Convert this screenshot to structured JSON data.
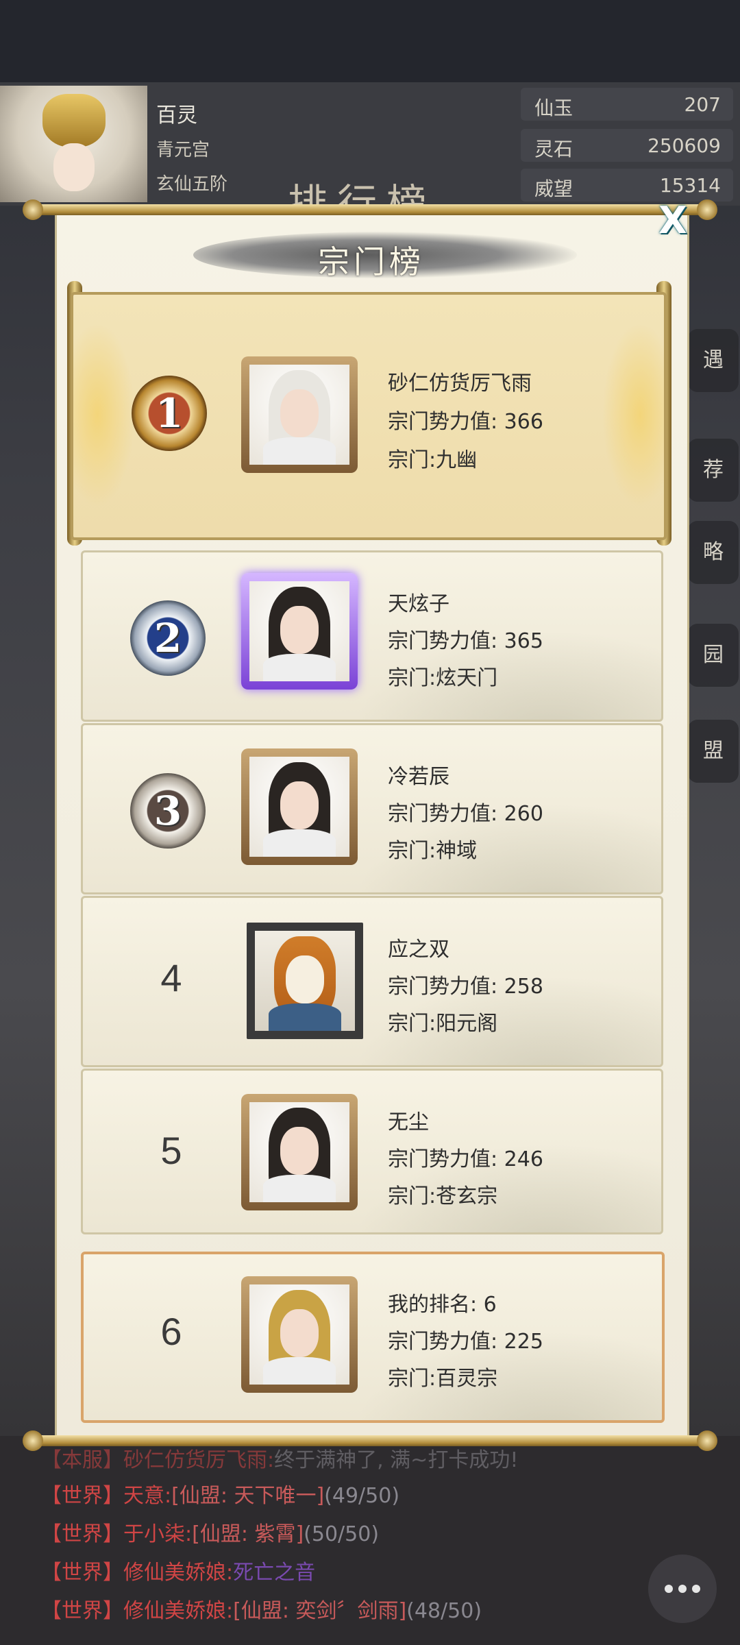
{
  "header": {
    "player_name": "百灵",
    "player_sect": "青元宫",
    "player_realm": "玄仙五阶",
    "bg_title": "排行榜"
  },
  "stats": [
    {
      "label": "仙玉",
      "value": "207"
    },
    {
      "label": "灵石",
      "value": "250609"
    },
    {
      "label": "威望",
      "value": "15314"
    }
  ],
  "side_icons": [
    "遇",
    "荐",
    "略",
    "园",
    "盟"
  ],
  "modal": {
    "title": "宗门榜",
    "close_label": "X",
    "power_label": "宗门势力值:",
    "sect_label": "宗门:",
    "entries": [
      {
        "rank": "1",
        "name": "砂仁仿货厉飞雨",
        "power": "366",
        "sect": "九幽"
      },
      {
        "rank": "2",
        "name": "天炫子",
        "power": "365",
        "sect": "炫天门"
      },
      {
        "rank": "3",
        "name": "冷若辰",
        "power": "260",
        "sect": "神域"
      },
      {
        "rank": "4",
        "name": "应之双",
        "power": "258",
        "sect": "阳元阁"
      },
      {
        "rank": "5",
        "name": "无尘",
        "power": "246",
        "sect": "苍玄宗"
      }
    ],
    "my_rank": {
      "rank": "6",
      "label": "我的排名: 6",
      "power": "225",
      "sect": "百灵宗"
    }
  },
  "chat": [
    {
      "channel": "【本服】",
      "name": "砂仁仿货厉飞雨:",
      "alliance": "",
      "content": "终于满神了, 满~打卡成功!"
    },
    {
      "channel": "【世界】",
      "name": "天意:",
      "alliance": "[仙盟: 天下唯一]",
      "content": "(49/50)"
    },
    {
      "channel": "【世界】",
      "name": "于小柒:",
      "alliance": "[仙盟: 紫霄]",
      "content": "(50/50)"
    },
    {
      "channel": "【世界】",
      "name": "修仙美娇娘:",
      "alliance": "死亡之音",
      "content": ""
    },
    {
      "channel": "【世界】",
      "name": "修仙美娇娘:",
      "alliance": "[仙盟: 奕剑〞剑雨]",
      "content": "(48/50)"
    }
  ],
  "colors": {
    "modal_bg": "#f6f3e6",
    "gold_border": "#b59b5b",
    "my_border": "#d9a46a",
    "chat_red": "#d04545"
  }
}
